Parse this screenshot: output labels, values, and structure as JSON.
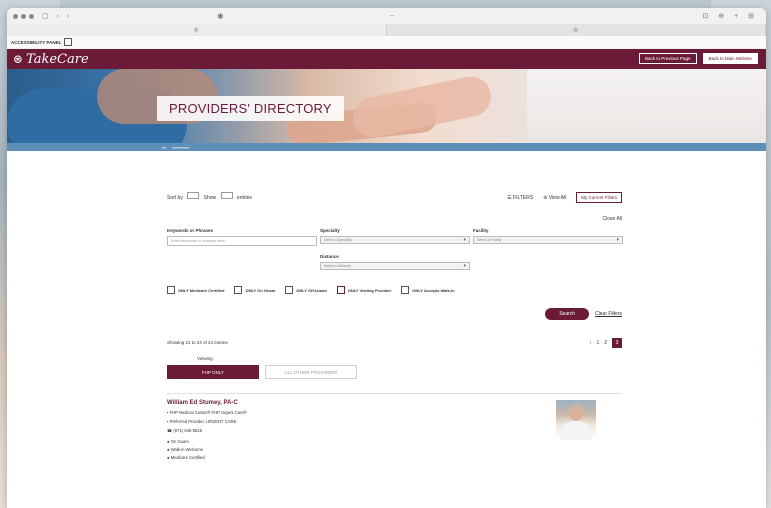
{
  "browser": {
    "tab1": "Ⓑ",
    "tab2": "Ⓑ",
    "center_icon": "✱"
  },
  "accessibility": {
    "label": "ACCESSIBILITY PANEL"
  },
  "header": {
    "logo": "TakeCare",
    "back_prev": "Back to Previous Page",
    "back_main": "Back to Main Website"
  },
  "hero": {
    "title": "PROVIDERS' DIRECTORY"
  },
  "toolbar": {
    "sort_label": "Sort by",
    "show_label": "Show",
    "entries_label": "entries",
    "filters": "FILTERS",
    "view_all": "View All",
    "my_current": "My Current Filters"
  },
  "filters": {
    "close_all": "Close All",
    "keywords_label": "Keywords or Phrases",
    "keywords_placeholder": "Enter keywords or phrases here",
    "specialty_label": "Specialty",
    "specialty_value": "Select a Specialty",
    "facility_label": "Facility",
    "facility_value": "Select a Facility",
    "distance_label": "Distance",
    "distance_value": "Select a Distance",
    "checks": [
      "ONLY Medicare Certified",
      "ONLY On Guam",
      "ONLY Off-Island",
      "ONLY Visiting Provider",
      "ONLY Accepts Walk-In"
    ],
    "search": "Search",
    "clear": "Clear Filters"
  },
  "results": {
    "showing": "Showing 21 to 24 of 24 entries",
    "viewing": "Viewing",
    "tab_fhp": "FHP ONLY",
    "tab_all": "ALL OTHER PROVIDERS",
    "pages": [
      "‹",
      "1",
      "2",
      "3"
    ]
  },
  "provider": {
    "name": "William Ed Stumey, PA-C",
    "line1": "FHP Medical Center® FHP Urgent Care®",
    "line2": "Preferred Provider, URGENT CARE",
    "line3": "(671) 646-5825",
    "b1": "On Guam",
    "b2": "Walk-in Welcome",
    "b3": "Medicare Certified"
  }
}
